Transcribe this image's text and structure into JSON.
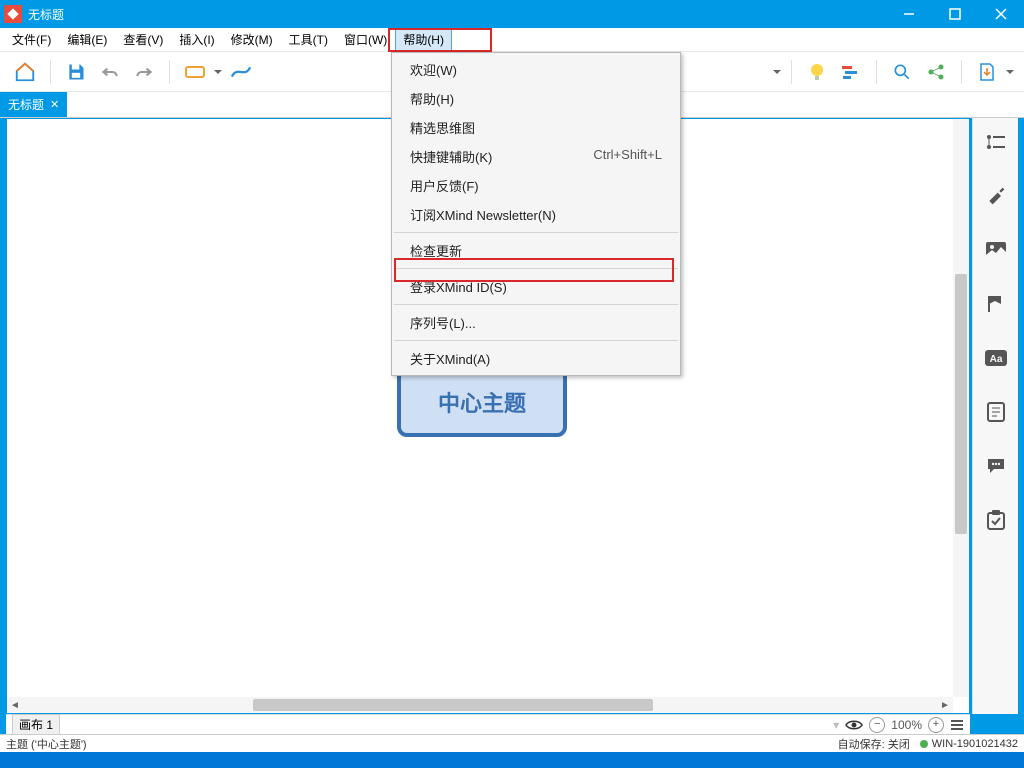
{
  "window": {
    "title": "无标题"
  },
  "menubar": {
    "items": [
      {
        "label": "文件(F)"
      },
      {
        "label": "编辑(E)"
      },
      {
        "label": "查看(V)"
      },
      {
        "label": "插入(I)"
      },
      {
        "label": "修改(M)"
      },
      {
        "label": "工具(T)"
      },
      {
        "label": "窗口(W)"
      },
      {
        "label": "帮助(H)"
      }
    ],
    "active_index": 7
  },
  "tab": {
    "label": "无标题"
  },
  "canvas": {
    "central_topic": "中心主题"
  },
  "dropdown": {
    "items": [
      {
        "label": "欢迎(W)",
        "shortcut": ""
      },
      {
        "label": "帮助(H)",
        "shortcut": ""
      },
      {
        "label": "精选思维图",
        "shortcut": ""
      },
      {
        "label": "快捷键辅助(K)",
        "shortcut": "Ctrl+Shift+L"
      },
      {
        "label": "用户反馈(F)",
        "shortcut": ""
      },
      {
        "label": "订阅XMind Newsletter(N)",
        "shortcut": ""
      },
      {
        "sep": true
      },
      {
        "label": "检查更新",
        "shortcut": ""
      },
      {
        "sep": true
      },
      {
        "label": "登录XMind ID(S)",
        "shortcut": ""
      },
      {
        "sep": true
      },
      {
        "label": "序列号(L)...",
        "shortcut": ""
      },
      {
        "sep": true
      },
      {
        "label": "关于XMind(A)",
        "shortcut": ""
      }
    ]
  },
  "bottom": {
    "sheet_label": "画布 1",
    "zoom_pct": "100%"
  },
  "status": {
    "left": "主题 ('中心主题')",
    "autosave": "自动保存: 关闭",
    "host": "WIN-1901021432"
  }
}
